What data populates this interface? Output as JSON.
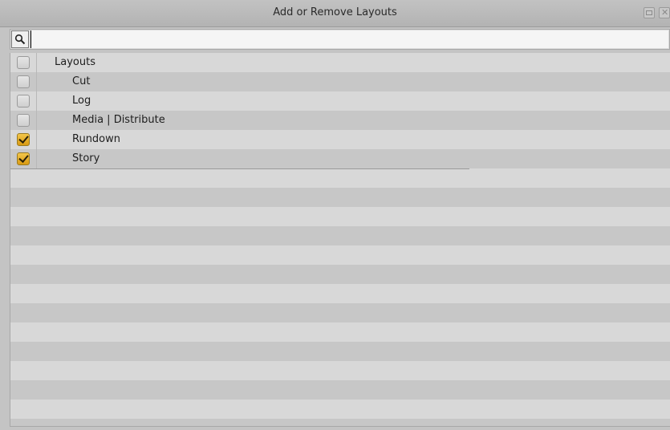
{
  "window": {
    "title": "Add or Remove Layouts"
  },
  "search": {
    "value": "",
    "placeholder": ""
  },
  "tree": {
    "root": {
      "label": "Layouts",
      "checked": false
    },
    "items": [
      {
        "label": "Cut",
        "checked": false
      },
      {
        "label": "Log",
        "checked": false
      },
      {
        "label": "Media | Distribute",
        "checked": false
      },
      {
        "label": "Rundown",
        "checked": true
      },
      {
        "label": "Story",
        "checked": true
      }
    ]
  },
  "colors": {
    "checked_fill": "#e8b230",
    "row_light": "#d8d8d8",
    "row_dark": "#c7c7c7",
    "titlebar": "#bcbcbc"
  },
  "icons": {
    "search": "magnifier-icon",
    "restore": "restore-window-icon",
    "close": "close-icon"
  }
}
